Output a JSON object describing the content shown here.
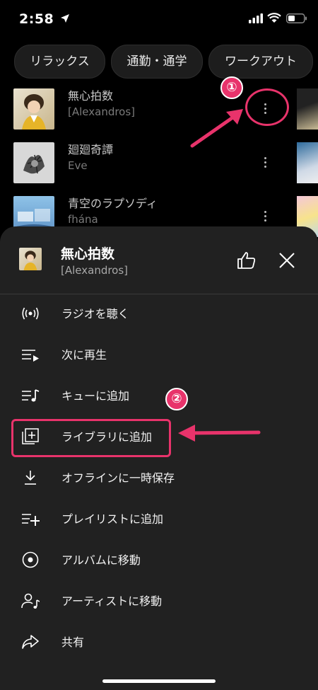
{
  "status_bar": {
    "time": "2:58"
  },
  "chips": [
    "リラックス",
    "通勤・通学",
    "ワークアウト"
  ],
  "songs": [
    {
      "title": "無心拍数",
      "artist": "[Alexandros]"
    },
    {
      "title": "廻廻奇譚",
      "artist": "Eve"
    },
    {
      "title": "青空のラプソディ",
      "artist": "fhána"
    }
  ],
  "annotations": {
    "step1": "①",
    "step2": "②"
  },
  "sheet": {
    "title": "無心拍数",
    "artist": "[Alexandros]",
    "items": [
      {
        "label": "ラジオを聴く",
        "icon": "radio-icon"
      },
      {
        "label": "次に再生",
        "icon": "play-next-icon"
      },
      {
        "label": "キューに追加",
        "icon": "queue-music-icon"
      },
      {
        "label": "ライブラリに追加",
        "icon": "library-add-icon"
      },
      {
        "label": "オフラインに一時保存",
        "icon": "download-icon"
      },
      {
        "label": "プレイリストに追加",
        "icon": "playlist-add-icon"
      },
      {
        "label": "アルバムに移動",
        "icon": "album-icon"
      },
      {
        "label": "アーティストに移動",
        "icon": "artist-icon"
      },
      {
        "label": "共有",
        "icon": "share-icon"
      }
    ]
  },
  "colors": {
    "accent": "#e8336b",
    "sheet_bg": "#212121",
    "background": "#000000"
  }
}
